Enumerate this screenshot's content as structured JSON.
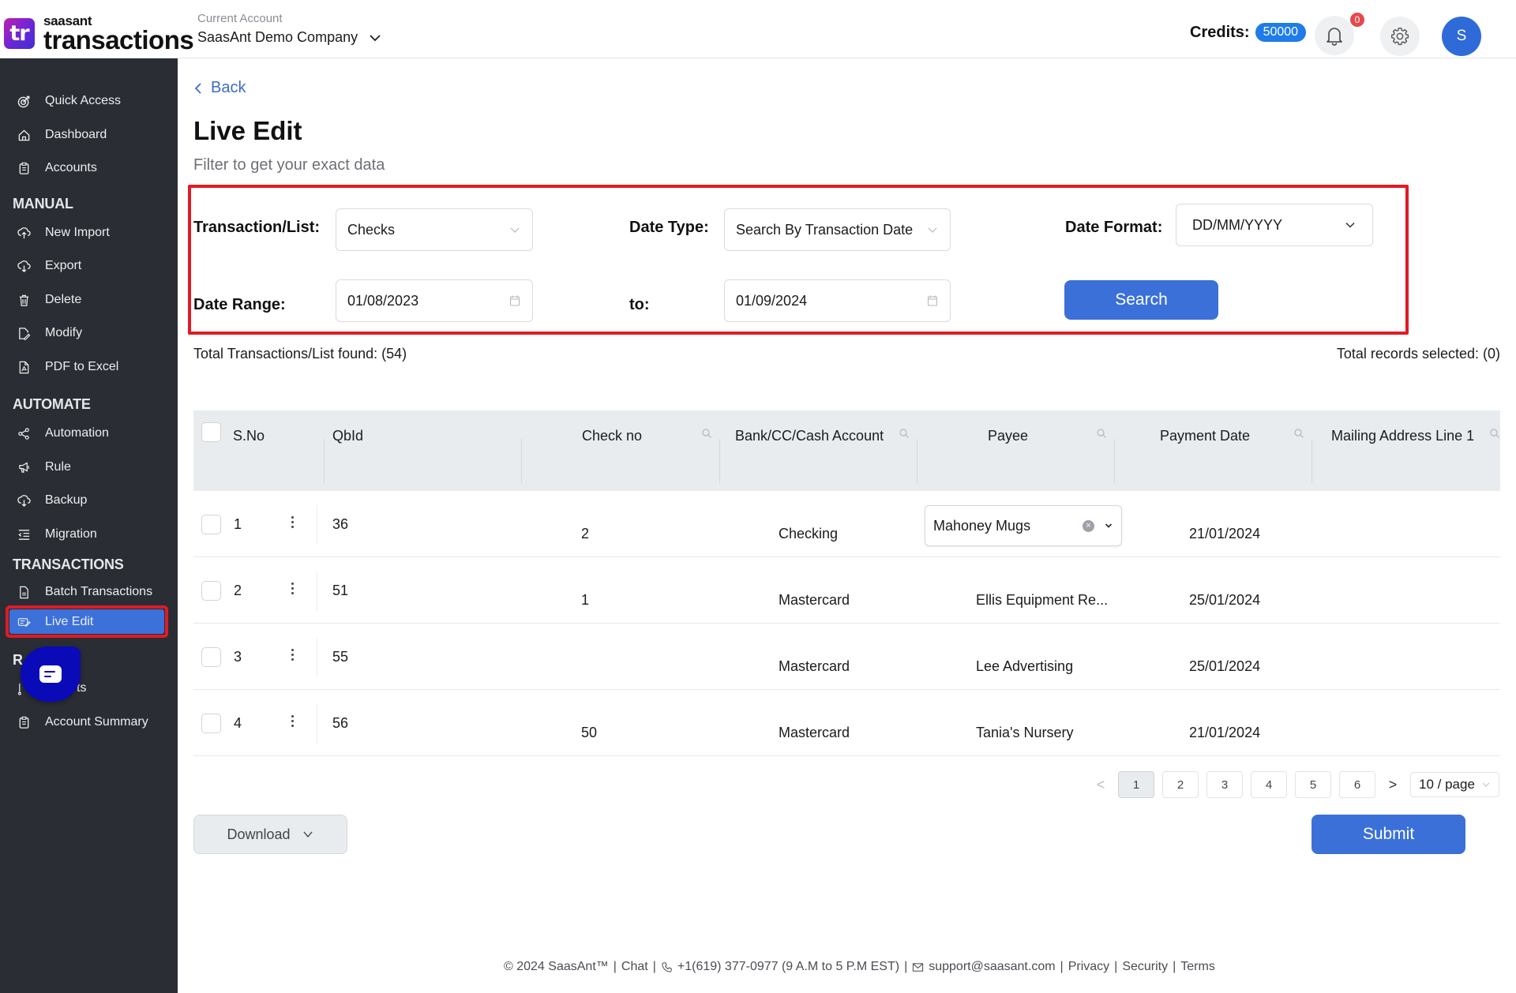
{
  "header": {
    "logo_mark": "tr",
    "logo_small": "saasant",
    "logo_big": "transactions",
    "account_label": "Current Account",
    "account_name": "SaasAnt Demo Company",
    "credits_label": "Credits:",
    "credits_value": "50000",
    "notification_count": "0",
    "avatar_initial": "S"
  },
  "sidebar": {
    "items_top": [
      {
        "label": "Quick Access",
        "icon": "target-icon"
      },
      {
        "label": "Dashboard",
        "icon": "home-icon"
      },
      {
        "label": "Accounts",
        "icon": "clipboard-icon"
      }
    ],
    "sections": [
      {
        "title": "MANUAL",
        "items": [
          {
            "label": "New Import",
            "icon": "cloud-upload-icon"
          },
          {
            "label": "Export",
            "icon": "cloud-download-icon"
          },
          {
            "label": "Delete",
            "icon": "trash-icon"
          },
          {
            "label": "Modify",
            "icon": "file-edit-icon"
          },
          {
            "label": "PDF to Excel",
            "icon": "pdf-icon"
          }
        ]
      },
      {
        "title": "AUTOMATE",
        "items": [
          {
            "label": "Automation",
            "icon": "share-icon"
          },
          {
            "label": "Rule",
            "icon": "megaphone-icon"
          },
          {
            "label": "Backup",
            "icon": "cloud-download-icon"
          },
          {
            "label": "Migration",
            "icon": "list-indent-icon"
          }
        ]
      },
      {
        "title": "TRANSACTIONS",
        "items": [
          {
            "label": "Batch Transactions",
            "icon": "document-icon"
          },
          {
            "label": "Live Edit",
            "icon": "edit-icon",
            "active": true
          }
        ]
      },
      {
        "title": "REPORTS",
        "items": [
          {
            "label": "Reports",
            "icon": "report-icon"
          },
          {
            "label": "Account Summary",
            "icon": "clipboard-icon"
          }
        ]
      }
    ],
    "section_visible_title_4": "R",
    "reports_item_visible": "ts"
  },
  "main": {
    "back_label": "Back",
    "title": "Live Edit",
    "subtitle": "Filter to get your exact data",
    "filters": {
      "transaction_label": "Transaction/List:",
      "transaction_value": "Checks",
      "date_type_label": "Date Type:",
      "date_type_value": "Search By Transaction Date",
      "date_format_label": "Date Format:",
      "date_format_value": "DD/MM/YYYY",
      "date_range_label": "Date Range:",
      "date_from": "01/08/2023",
      "to_label": "to:",
      "date_to": "01/09/2024",
      "search_label": "Search"
    },
    "total_found": "Total Transactions/List found: (54)",
    "total_selected": "Total records selected: (0)",
    "table": {
      "columns": [
        "S.No",
        "QbId",
        "Check no",
        "Bank/CC/Cash Account",
        "Payee",
        "Payment Date",
        "Mailing Address Line 1"
      ],
      "rows": [
        {
          "sno": "1",
          "qbid": "36",
          "check_no": "2",
          "account": "Checking",
          "payee": "Mahoney Mugs",
          "payee_editable": true,
          "payment_date": "21/01/2024",
          "mailing": ""
        },
        {
          "sno": "2",
          "qbid": "51",
          "check_no": "1",
          "account": "Mastercard",
          "payee": "Ellis Equipment Re...",
          "payment_date": "25/01/2024",
          "mailing": ""
        },
        {
          "sno": "3",
          "qbid": "55",
          "check_no": "",
          "account": "Mastercard",
          "payee": "Lee Advertising",
          "payment_date": "25/01/2024",
          "mailing": ""
        },
        {
          "sno": "4",
          "qbid": "56",
          "check_no": "50",
          "account": "Mastercard",
          "payee": "Tania's Nursery",
          "payment_date": "21/01/2024",
          "mailing": ""
        }
      ]
    },
    "pagination": {
      "pages": [
        "1",
        "2",
        "3",
        "4",
        "5",
        "6"
      ],
      "current": "1",
      "page_size": "10 / page"
    },
    "download_label": "Download",
    "submit_label": "Submit"
  },
  "footer": {
    "copyright": "© 2024 SaasAnt™",
    "chat": "Chat",
    "phone": "+1(619) 377-0977 (9 A.M to 5 P.M EST)",
    "email": "support@saasant.com",
    "privacy": "Privacy",
    "security": "Security",
    "terms": "Terms",
    "separator": "|"
  },
  "colors": {
    "primary": "#3b70d9",
    "sidebar_bg": "#2a2d33",
    "highlight_outline": "#e01b24",
    "credits_badge": "#1f7ce8",
    "chat_fab": "#0a0ab8"
  }
}
